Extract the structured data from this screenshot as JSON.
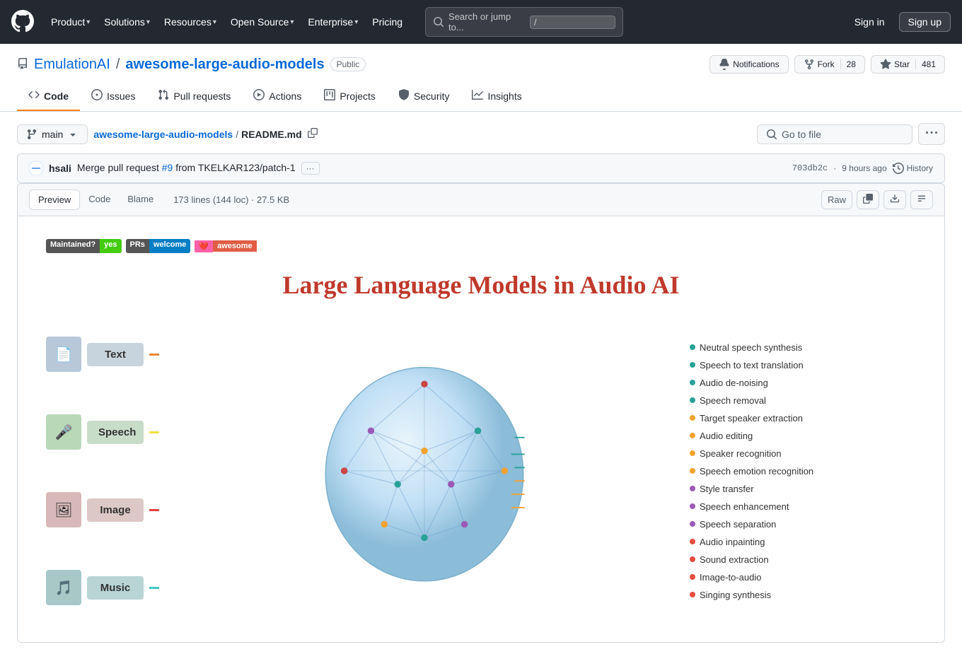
{
  "header": {
    "logo_label": "GitHub",
    "nav": [
      {
        "id": "product",
        "label": "Product",
        "has_chevron": true
      },
      {
        "id": "solutions",
        "label": "Solutions",
        "has_chevron": true
      },
      {
        "id": "resources",
        "label": "Resources",
        "has_chevron": true
      },
      {
        "id": "open-source",
        "label": "Open Source",
        "has_chevron": true
      },
      {
        "id": "enterprise",
        "label": "Enterprise",
        "has_chevron": true
      },
      {
        "id": "pricing",
        "label": "Pricing",
        "has_chevron": false
      }
    ],
    "search_placeholder": "Search or jump to...",
    "search_shortcut": "/",
    "signin_label": "Sign in",
    "signup_label": "Sign up"
  },
  "repo": {
    "owner": "EmulationAI",
    "name": "awesome-large-audio-models",
    "visibility": "Public",
    "notifications_label": "Notifications",
    "fork_label": "Fork",
    "fork_count": "28",
    "star_label": "Star",
    "star_count": "481"
  },
  "repo_nav": [
    {
      "id": "code",
      "label": "Code",
      "active": true,
      "icon": "code"
    },
    {
      "id": "issues",
      "label": "Issues",
      "active": false,
      "icon": "issue"
    },
    {
      "id": "pull-requests",
      "label": "Pull requests",
      "active": false,
      "icon": "git-pull-request"
    },
    {
      "id": "actions",
      "label": "Actions",
      "active": false,
      "icon": "play"
    },
    {
      "id": "projects",
      "label": "Projects",
      "active": false,
      "icon": "table"
    },
    {
      "id": "security",
      "label": "Security",
      "active": false,
      "icon": "shield"
    },
    {
      "id": "insights",
      "label": "Insights",
      "active": false,
      "icon": "graph"
    }
  ],
  "file_toolbar": {
    "branch_label": "main",
    "repo_path": "awesome-large-audio-models",
    "file_name": "README.md",
    "copy_tooltip": "Copy path",
    "goto_file_placeholder": "Go to file",
    "more_options_label": "..."
  },
  "commit": {
    "author": "hsali",
    "message": "Merge pull request",
    "pr_number": "#9",
    "pr_suffix": "from TKELKAR123/patch-1",
    "hash": "703db2c",
    "time": "9 hours ago",
    "history_label": "History"
  },
  "file_view": {
    "tabs": [
      {
        "id": "preview",
        "label": "Preview",
        "active": true
      },
      {
        "id": "code",
        "label": "Code",
        "active": false
      },
      {
        "id": "blame",
        "label": "Blame",
        "active": false
      }
    ],
    "stats": "173 lines (144 loc) · 27.5 KB",
    "actions": [
      "Raw",
      "Copy",
      "Download",
      "Outline"
    ]
  },
  "readme": {
    "badges": [
      {
        "left": "Maintained?",
        "right": "yes",
        "right_color": "green"
      },
      {
        "left": "PRs",
        "right": "welcome",
        "right_color": "blue"
      },
      {
        "left": "awesome",
        "type": "awesome"
      }
    ],
    "title": "Large Language Models in Audio AI",
    "left_items": [
      {
        "label": "Text",
        "color": "#c8d8e8",
        "icon": "📄"
      },
      {
        "label": "Speech",
        "color": "#c8e8c8",
        "icon": "🎤"
      },
      {
        "label": "Image",
        "color": "#e8c8c8",
        "icon": "🖼"
      },
      {
        "label": "Music",
        "color": "#a8d8d8",
        "icon": "🎵"
      }
    ],
    "right_items": [
      {
        "bullet": "teal",
        "text": "Neutral speech synthesis"
      },
      {
        "bullet": "teal",
        "text": "Speech to text translation"
      },
      {
        "bullet": "teal",
        "text": "Audio de-noising"
      },
      {
        "bullet": "teal",
        "text": "Speech removal"
      },
      {
        "bullet": "orange",
        "text": "Target speaker extraction"
      },
      {
        "bullet": "orange",
        "text": "Audio editing"
      },
      {
        "bullet": "orange",
        "text": "Speaker recognition"
      },
      {
        "bullet": "orange",
        "text": "Speech emotion recognition"
      },
      {
        "bullet": "purple",
        "text": "Style transfer"
      },
      {
        "bullet": "purple",
        "text": "Speech enhancement"
      },
      {
        "bullet": "purple",
        "text": "Speech separation"
      },
      {
        "bullet": "red",
        "text": "Audio inpainting"
      },
      {
        "bullet": "red",
        "text": "Sound extraction"
      },
      {
        "bullet": "red",
        "text": "Image-to-audio"
      },
      {
        "bullet": "red",
        "text": "Singing synthesis"
      }
    ]
  }
}
